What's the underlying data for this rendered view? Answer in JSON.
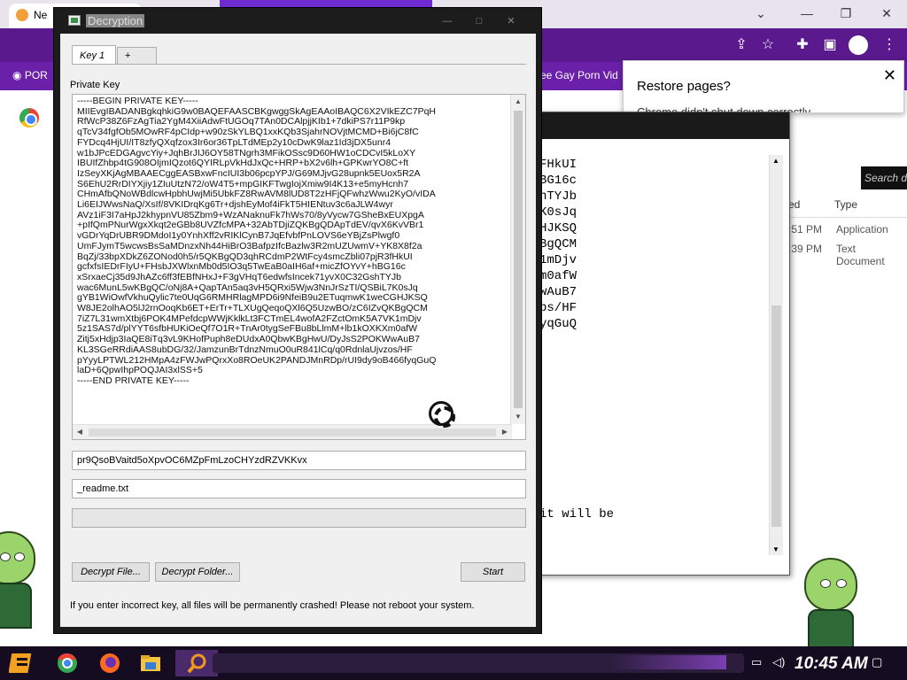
{
  "browser": {
    "tab_title": "Ne",
    "bookmarks": [
      "POR",
      "ee Gay Porn Vid"
    ],
    "restore": {
      "title": "Restore pages?",
      "body": "Chrome didn't shut down correctly"
    }
  },
  "notepad": {
    "lines": [
      "FHkUI",
      "BG16c",
      "nTYJb",
      "K0sJq",
      "HJKSQ",
      "BgQCM",
      "1mDjv",
      "m0afW",
      "wAuB7",
      "bs/HF",
      "yqGuQ"
    ],
    "footer_line": "it will be"
  },
  "explorer": {
    "search_placeholder": "Search de",
    "col_modified": "ed",
    "col_type": "Type",
    "rows": [
      {
        "time": ":51 PM",
        "type": "Application"
      },
      {
        "time": ":39 PM",
        "type": "Text Document"
      }
    ]
  },
  "dialog": {
    "title": "Decryption",
    "tabs": {
      "active": "Key 1",
      "add": "+"
    },
    "private_key_label": "Private Key",
    "private_key": "-----BEGIN PRIVATE KEY-----\nMIIEvgIBADANBgkqhkiG9w0BAQEFAASCBKgwggSkAgEAAoIBAQC6X2VIkEZC7PqH\nRfWcP38Z6FzAgTia2YgM4XiiAdwFtUGOq7TAn0DCAlpjjKIb1+7dkiPS7r11P9kp\nqTcV34fgfOb5MOwRF4pCIdp+w90zSkYLBQ1xxKQb3SjahrNOVjtMCMD+Bi6jC8fC\nFYDcq4HjUI/IT8zfyQXqfzox3Ir6or36TpLTdMEp2y10cDwK9laz1Id3jDX5unr4\nw1bJPcEDGAgvcYiy+JqhBrJIJ6OY58TNgrh3MFikOSsc9D60HW1oCDCvI5kLoXY\nIBUIfZhbp4tG908OIjmIQzot6QYIRLpVkHdJxQc+HRP+bX2v6lh+GPKwrYO8C+ft\nIzSeyXKjAgMBAAECggEASBxwFncIUI3b06pcpYPJ/G69MJjvG28upnk5EUox5R2A\nS6EhU2RrDIYXjiy1ZIuUtzN72/oW4T5+mpGIKFTwgIojXmiw9I4K13+e5myHcnh7\nCHmAfbQNoWBdlcwHpbhUwjMi5UbkFZ8RwAVM8lUD8T2zHFjQFwhzWwu2KyO/vIDA\nLi6EIJWwsNaQ/XsIf/8VKIDrqKg6Tr+djshEyMof4iFkT5HIENtuv3c6aJLW4wyr\nAVz1iF3I7aHpJ2khypnVU85Zbm9+WzANaknuFk7hWs70/8yVycw7GSheBxEUXpgA\n+pIfQmPNurWgxXkqt2eGBb8UVZfcMPA+32AbTDjiZQKBgQDApTdEV/qvX6KvVBr1\nvGDrYqDrUBR9DMdoI1y0YnhXff2vRIKlCynB7JqEfvbfPnLOVS6eYBjZsPlwgf0\nUmFJymT5wcwsBsSaMDnzxNh44HiBrO3BafpzIfcBazlw3R2mUZUwmV+YK8X8f2a\nBqZj/33bpXDkZ6ZONod0h5/r5QKBgQD3qhRCdmP2WtFcy4smcZbli07pjR3fHkUI\ngcfxfsIEDrFIyU+FHsbJXWlxnMb0d5IO3q5TwEaB0aIH6af+micZfOYvY+hBG16c\nxSrxaeCj35d9JhAZc6ff3fEBfNHxJ+F3gVHqT6edwfsIncek71yvX0C32GshTYJb\nwac6MunL5wKBgQC/oNj8A+QapTAn5aq3vH5QRxi5Wjw3NnJrSzTI/QSBiL7K0sJq\ngYB1WiOwfVkhuQylic7te0UqG6RMHRlagMPD6i9NfeiB9u2ETuqmwK1weCGHJKSQ\nW8JE2olhAO5lJ2rnOoqKb6ET+ErTr+TLXUgQeqoQXl6Q5UzwBO/zC6IZvQKBgQCM\n7iZ7L31wmXtbj6POK4MPefdcpWWjKklkLt3FCTmEL4wofA2FZctOmK5A7VK1mDjv\n5z1SAS7d/plYYT6sfbHUKiOeQf7O1R+TnAr0tygSeFBu8bLlmM+lb1kOXKXm0afW\nZitj5xHdjp3IaQE8iTq3vL9KHofPuph8eDUdxA0QbwKBgHwU/DyJsS2POKWwAuB7\nKL3SGeRRdiAAS8ubDG/32/JamzunBrTdnzNmuO0uR841lCq/q0RdnlaUjvzos/HF\npYyyLPTWL212HMpA4zFWJwPQrxXo8ROeUK2PANDJMnRDp/rUI9dy9oB466fyqGuQ\nlaD+6QpwIhpPOQJAI3xlSS+5\n-----END PRIVATE KEY-----",
    "key_id": "pr9QsoBVaitd5oXpvOC6MZpFmLzoCHYzdRZVKKvx",
    "filename": "_readme.txt",
    "progress": 0,
    "buttons": {
      "decrypt_file": "Decrypt File...",
      "decrypt_folder": "Decrypt Folder...",
      "start": "Start"
    },
    "warning": "If you enter incorrect key, all files will be permanently crashed! Please not reboot your system."
  },
  "taskbar": {
    "time": "10:45 AM"
  },
  "colors": {
    "accent_purple": "#6a20a8",
    "taskbar": "#160c22",
    "dialog_frame": "#1c1c1c"
  }
}
